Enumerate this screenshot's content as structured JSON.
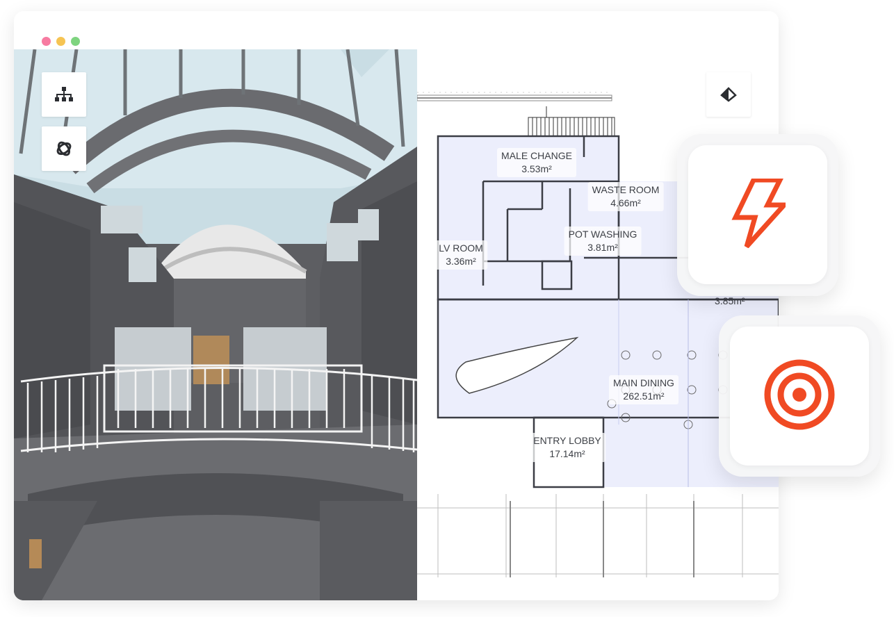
{
  "window": {
    "controls": [
      {
        "name": "close",
        "color": "#f77ba1"
      },
      {
        "name": "minimize",
        "color": "#f6c453"
      },
      {
        "name": "maximize",
        "color": "#7ed47f"
      }
    ]
  },
  "viewer_3d": {
    "tools": [
      {
        "name": "hierarchy-icon"
      },
      {
        "name": "orbit-icon"
      }
    ]
  },
  "floor_plan": {
    "tools": [
      {
        "name": "section-plane-icon"
      }
    ],
    "rooms": [
      {
        "name": "MALE CHANGE",
        "area": "3.53m²"
      },
      {
        "name": "WASTE ROOM",
        "area": "4.66m²"
      },
      {
        "name": "POT WASHING",
        "area": "3.81m²"
      },
      {
        "name": "LV ROOM",
        "area": "3.36m²"
      },
      {
        "name": "MAIN DINING",
        "area": "262.51m²"
      },
      {
        "name": "ENTRY LOBBY",
        "area": "17.14m²"
      }
    ],
    "hidden_room_area": "3.85m²"
  },
  "feature_cards": [
    {
      "icon": "lightning-bolt-icon",
      "color": "#f04a23"
    },
    {
      "icon": "target-icon",
      "color": "#f04a23"
    }
  ]
}
